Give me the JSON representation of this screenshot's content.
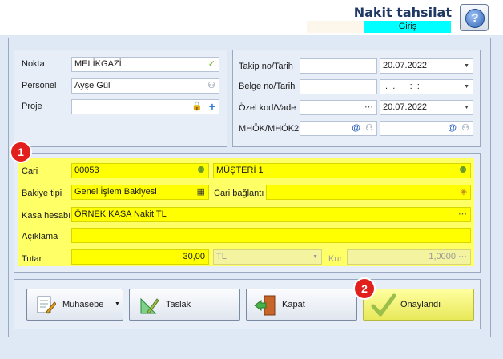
{
  "header": {
    "title": "Nakit tahsilat",
    "mode": "Giriş"
  },
  "left_form": {
    "nokta_label": "Nokta",
    "nokta_value": "MELİKGAZİ",
    "personel_label": "Personel",
    "personel_value": "Ayşe Gül",
    "proje_label": "Proje",
    "proje_value": ""
  },
  "right_form": {
    "takip_label": "Takip no/Tarih",
    "takip_value": "",
    "takip_date": "20.07.2022",
    "belge_label": "Belge no/Tarih",
    "belge_value": "",
    "belge_date": " .  .      :  :",
    "ozel_label": "Özel kod/Vade",
    "ozel_value": "",
    "ozel_date": "20.07.2022",
    "mhok_label": "MHÖK/MHÖK2",
    "mhok_value": "",
    "mhok2_value": ""
  },
  "cari_section": {
    "cari_label": "Cari",
    "cari_code": "00053",
    "cari_name": "MÜŞTERİ 1",
    "bakiye_label": "Bakiye tipi",
    "bakiye_value": "Genel İşlem Bakiyesi",
    "cari_baglanti_label": "Cari bağlantı",
    "cari_baglanti_value": "",
    "kasa_label": "Kasa hesabı",
    "kasa_value": "ÖRNEK KASA Nakit TL",
    "aciklama_label": "Açıklama",
    "aciklama_value": "",
    "tutar_label": "Tutar",
    "tutar_value": "30,00",
    "currency_value": "TL",
    "kur_label": "Kur",
    "kur_value": "1,0000"
  },
  "buttons": {
    "muhasebe": "Muhasebe",
    "taslak": "Taslak",
    "kapat": "Kapat",
    "onaylandi": "Onaylandı"
  },
  "badges": {
    "one": "1",
    "two": "2"
  },
  "colors": {
    "highlight": "#ffff00",
    "mode_bg": "#00ffff",
    "badge": "#e1201e",
    "title": "#1f3864"
  }
}
